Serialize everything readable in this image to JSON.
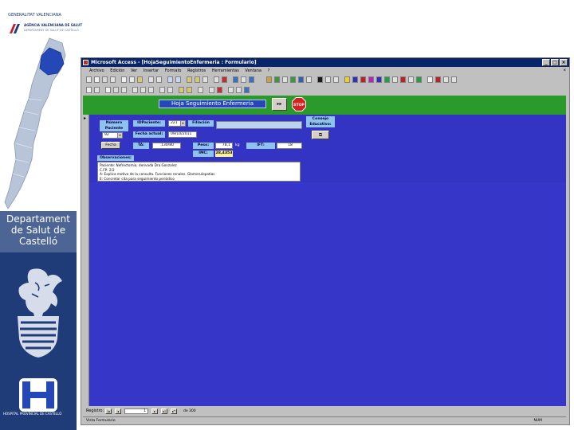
{
  "branding": {
    "org_line1": "GENERALITAT VALENCIANA",
    "org_line2": "AGÈNCIA VALENCIANA DE SALUT",
    "org_line3": "DEPARTAMENT DE SALUT DE CASTELLÓ",
    "dept_line1": "Departament",
    "dept_line2": "de Salut de",
    "dept_line3": "Castelló",
    "hospital_caption": "HOSPITAL PROVINCIAL DE CASTELLÓ"
  },
  "window": {
    "title": "Microsoft Access - [HojaSeguimientoEnfermeria : Formulario]",
    "controls": [
      "_",
      "□",
      "×"
    ]
  },
  "menu": {
    "items": [
      "Archivo",
      "Edición",
      "Ver",
      "Insertar",
      "Formato",
      "Registros",
      "Herramientas",
      "Ventana",
      "?"
    ],
    "close": "×"
  },
  "form": {
    "title": "Hoja Seguimiento Enfermeria",
    "nav_button": "▸▸",
    "stop_label": "STOP",
    "numero_paciente_label": "Número Paciente",
    "numero_paciente_value": "92",
    "fecha_btn": "Fecha",
    "id_paciente_label": "IDPaciente:",
    "id_paciente_value": "221",
    "filiacion_label": "Filiación",
    "filiacion_value": "",
    "fecha_actual_label": "Fecha actual:",
    "fecha_actual_value": "09/10/2011",
    "consejo_label": "Consejo Educativo:",
    "consejo_btn": "⧉",
    "ta_label": "TA:",
    "ta_value": "130/80",
    "peso_label": "Peso:",
    "peso_value": "78,1",
    "peso_unit": "kg",
    "ift_label": "IFT:",
    "ift_value": "18",
    "imc_label": "IMC:",
    "imc_value": "28,4353",
    "observaciones_label": "Observaciones:",
    "observaciones_lines": [
      "Paciente: Nefrectomía, derivada Dra Gonzalez",
      "C.FP: 2/2",
      "A: Explica motivo de la consulta. Funciones renales. Glomerulopatías",
      "E: Concretar cita para seguimiento periódico"
    ]
  },
  "navigation": {
    "label": "Registro:",
    "current": "1",
    "of_text": "de 300",
    "buttons": [
      "|◂",
      "◂",
      "▸",
      "▸|",
      "▸*"
    ]
  },
  "status": {
    "left": "Vista Formulario",
    "right": "NUM"
  },
  "colors": {
    "form_header_green": "#2a9a2a",
    "form_body_blue": "#3636c8",
    "title_bar": "#08246b",
    "label_light_blue": "#8fc3ef",
    "imc_yellow": "#fff38a"
  }
}
